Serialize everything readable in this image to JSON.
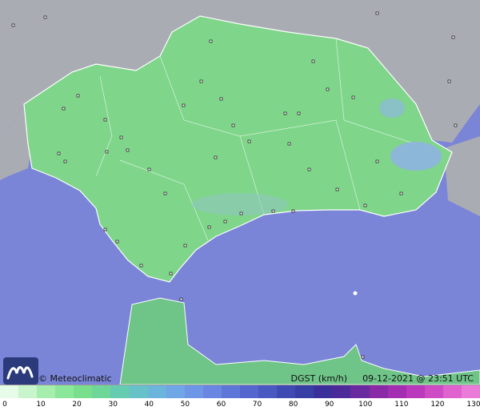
{
  "map": {
    "credit": "© Meteoclimatic",
    "variable_label": "DGST (km/h)",
    "timestamp": "09-12-2021 @ 23:51 UTC",
    "colors": {
      "sea": "#7b85d8",
      "land_outside": "#a9acb3",
      "region": "#7fd58a",
      "region_dark": "#63b878",
      "border": "#ffffff"
    }
  },
  "legend": {
    "ticks": [
      "0",
      "10",
      "20",
      "30",
      "40",
      "50",
      "60",
      "70",
      "80",
      "90",
      "100",
      "110",
      "120",
      "130"
    ],
    "colors": [
      "#e6fbe8",
      "#c8f5cc",
      "#a6eeae",
      "#8be79a",
      "#79df8c",
      "#6ed699",
      "#66ccb1",
      "#66c1c9",
      "#6bb5dd",
      "#6ea6e6",
      "#6d96e6",
      "#6886e2",
      "#5f76d9",
      "#5566cf",
      "#4a58c2",
      "#3f4ab3",
      "#373ea4",
      "#3a2f9b",
      "#4c2a9a",
      "#6a2aa0",
      "#8a2aa7",
      "#a32eb1",
      "#bb39bc",
      "#cf4bc6",
      "#df62cf",
      "#eb7bd8"
    ]
  }
}
